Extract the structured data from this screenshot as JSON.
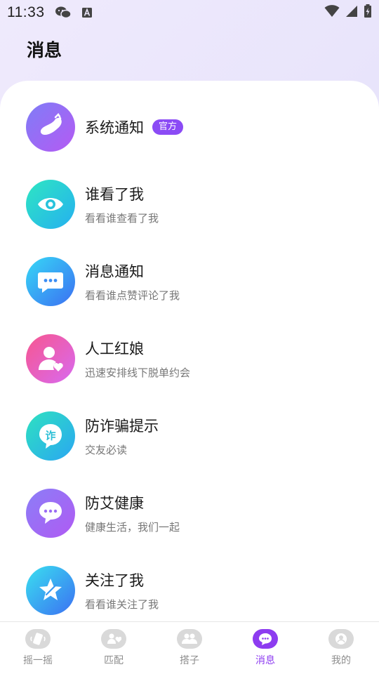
{
  "status_bar": {
    "time": "11:33"
  },
  "header": {
    "title": "消息"
  },
  "colors": {
    "accent": "#8d3cf0",
    "badge": "#8b4bf5"
  },
  "messages": [
    {
      "title": "系统通知",
      "badge": "官方",
      "subtitle": "",
      "icon": "eggplant-icon"
    },
    {
      "title": "谁看了我",
      "subtitle": "看看谁查看了我",
      "icon": "eye-icon"
    },
    {
      "title": "消息通知",
      "subtitle": "看看谁点赞评论了我",
      "icon": "chat-bubble-icon"
    },
    {
      "title": "人工红娘",
      "subtitle": "迅速安排线下脱单约会",
      "icon": "user-heart-icon"
    },
    {
      "title": "防诈骗提示",
      "subtitle": "交友必读",
      "icon": "zha-shield-icon"
    },
    {
      "title": "防艾健康",
      "subtitle": "健康生活，我们一起",
      "icon": "chat-bubbles-icon"
    },
    {
      "title": "关注了我",
      "subtitle": "看看谁关注了我",
      "icon": "star-icon"
    }
  ],
  "tabs": [
    {
      "label": "摇一摇",
      "icon": "shake-icon",
      "active": false
    },
    {
      "label": "匹配",
      "icon": "match-icon",
      "active": false
    },
    {
      "label": "搭子",
      "icon": "partner-icon",
      "active": false
    },
    {
      "label": "消息",
      "icon": "message-icon",
      "active": true
    },
    {
      "label": "我的",
      "icon": "profile-icon",
      "active": false
    }
  ]
}
